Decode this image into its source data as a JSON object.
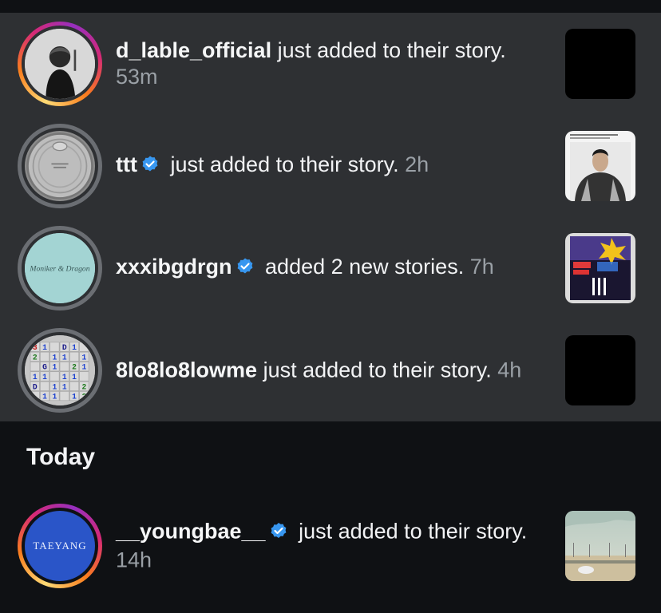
{
  "notifications_earlier": [
    {
      "username": "d_lable_official",
      "verified": false,
      "action": " just added to their story.",
      "time": "53m",
      "ring": "unseen",
      "thumb": "black"
    },
    {
      "username": "ttt",
      "verified": true,
      "action": " just added to their story.",
      "time": "2h",
      "ring": "seen",
      "thumb": "photo-man"
    },
    {
      "username": "xxxibgdrgn",
      "verified": true,
      "action": " added 2 new stories.",
      "time": "7h",
      "ring": "seen",
      "thumb": "photo-stage"
    },
    {
      "username": "8lo8lo8lowme",
      "verified": false,
      "action": " just added to their story.",
      "time": "4h",
      "ring": "seen",
      "thumb": "black"
    }
  ],
  "section_today": "Today",
  "notifications_today": [
    {
      "username": "__youngbae__",
      "verified": true,
      "action": " just added to their story.",
      "time": "14h",
      "ring": "unseen",
      "thumb": "photo-desert",
      "avatar_text": "TAEYANG"
    }
  ],
  "avatar_texts": {
    "xxxibgdrgn": "Moniker & Dragon",
    "minesweeper_grid": [
      "3",
      "1",
      "D",
      "1",
      "2",
      "1",
      "1",
      "1",
      "G",
      "1",
      "2",
      "1",
      "1",
      "1",
      "1",
      "1",
      "D",
      "1",
      "1",
      "2",
      "1",
      "1",
      "1",
      "2"
    ]
  },
  "colors": {
    "background": "#0f1114",
    "unread_background": "#2e3033",
    "verified": "#3897f0",
    "time": "#9aa0a6"
  }
}
